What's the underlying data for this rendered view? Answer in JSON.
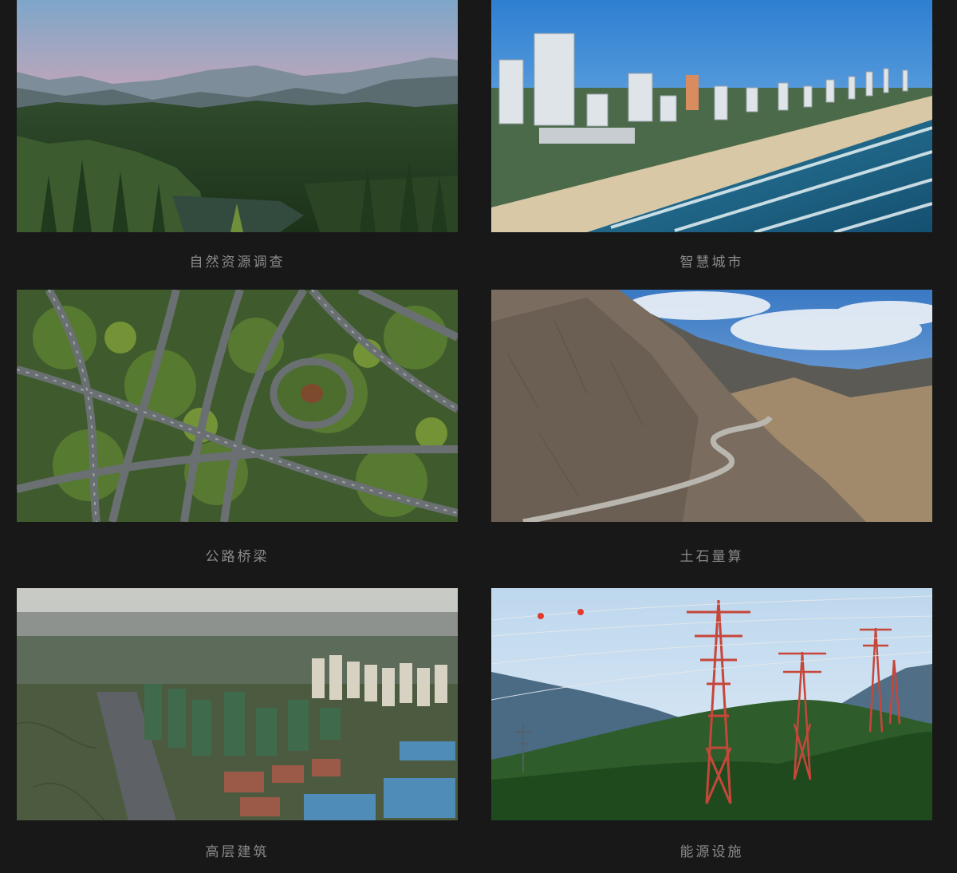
{
  "gallery": {
    "items": [
      {
        "label": "自然资源调查",
        "image": "forest-mountains-photo"
      },
      {
        "label": "智慧城市",
        "image": "coastal-city-photo"
      },
      {
        "label": "公路桥梁",
        "image": "highway-interchange-photo"
      },
      {
        "label": "土石量算",
        "image": "mountain-road-photo"
      },
      {
        "label": "高层建筑",
        "image": "high-rise-construction-photo"
      },
      {
        "label": "能源设施",
        "image": "power-transmission-towers-photo"
      }
    ]
  },
  "colors": {
    "background": "#181818",
    "caption_text": "#8a8a8a"
  }
}
